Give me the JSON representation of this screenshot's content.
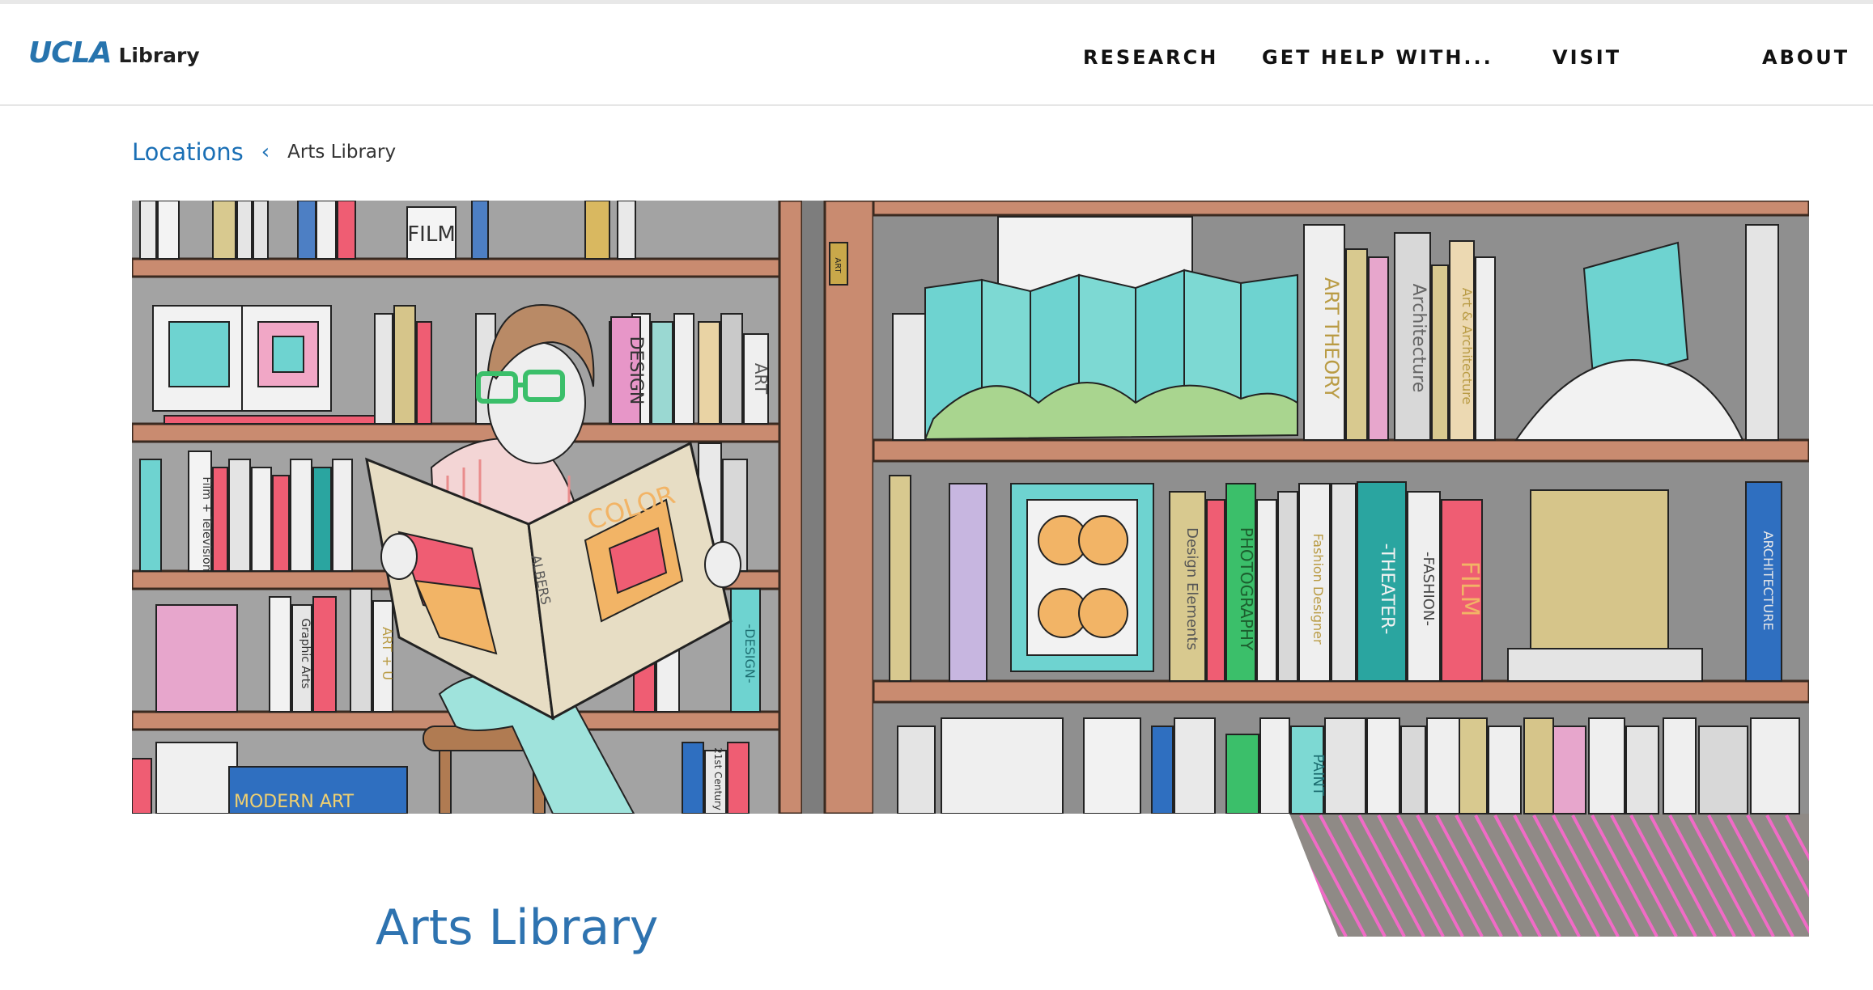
{
  "header": {
    "logo": {
      "brand": "UCLA",
      "sub": "Library"
    },
    "nav": [
      {
        "label": "RESEARCH"
      },
      {
        "label": "GET HELP WITH..."
      },
      {
        "label": "VISIT"
      },
      {
        "label": "ABOUT"
      }
    ]
  },
  "breadcrumb": {
    "parent": "Locations",
    "separator": "‹",
    "current": "Arts Library"
  },
  "hero": {
    "book_labels": {
      "film_sign": "FILM",
      "design": "DESIGN",
      "art": "ART",
      "film_tv": "Film + Television",
      "graphic_arts": "Graphic Arts",
      "art_u": "ART + U",
      "twentyfirst": "21st Century",
      "modern_art": "MODERN ART",
      "color": "COLOR",
      "albers": "ALBERS",
      "design_spine": "-DESIGN-",
      "art_theory": "ART THEORY",
      "architecture": "Architecture",
      "art_architecture": "Art & Architecture",
      "design_elements": "Design Elements",
      "photography": "PHOTOGRAPHY",
      "fashion_designer": "Fashion Designer",
      "theater": "-THEATER-",
      "fashion": "-FASHION-",
      "film": "FILM",
      "architecture2": "ARCHITECTURE",
      "paint": "PAINT",
      "art_sign": "ART"
    }
  },
  "page": {
    "title": "Arts Library"
  },
  "colors": {
    "brand_blue": "#2774ae",
    "title_blue": "#2e73b0",
    "shelf": "#c98b70",
    "accent_pink": "#f06bc6",
    "teal": "#6ed3d0"
  }
}
